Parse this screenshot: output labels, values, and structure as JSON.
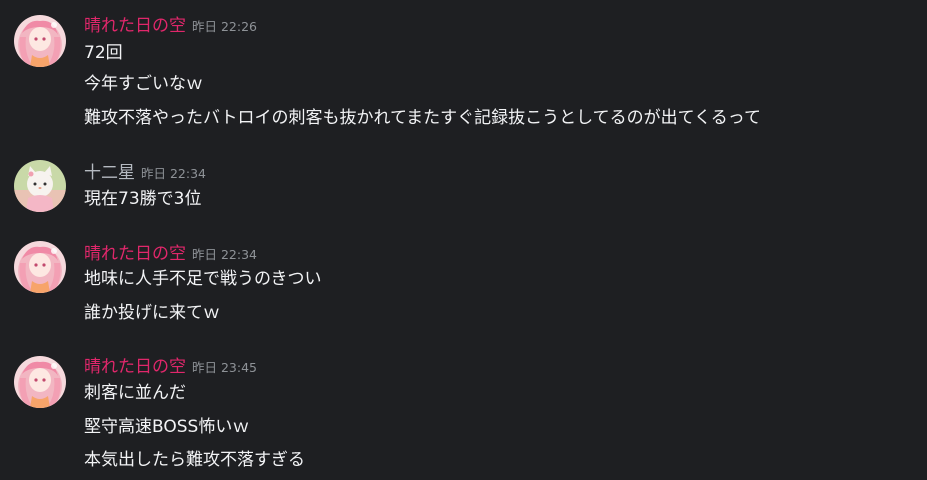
{
  "messages": [
    {
      "author": "晴れた日の空",
      "timestamp": "昨日 22:26",
      "lines": [
        "72回",
        "今年すごいなｗ",
        "難攻不落やったバトロイの刺客も抜かれてまたすぐ記録抜こうとしてるのが出てくるって"
      ]
    },
    {
      "author": "十二星",
      "timestamp": "昨日 22:34",
      "lines": [
        "現在73勝で3位"
      ]
    },
    {
      "author": "晴れた日の空",
      "timestamp": "昨日 22:34",
      "lines": [
        "地味に人手不足で戦うのきつい",
        "誰か投げに来てｗ"
      ]
    },
    {
      "author": "晴れた日の空",
      "timestamp": "昨日 23:45",
      "lines": [
        "刺客に並んだ",
        "堅守高速BOSS怖いｗ",
        "本気出したら難攻不落すぎる"
      ]
    }
  ],
  "colors": {
    "background": "#1e1f22",
    "author_pink": "#e0276b",
    "author_gray": "#b5bac1",
    "timestamp": "#8e9297",
    "message_text": "#f2f3f5"
  }
}
